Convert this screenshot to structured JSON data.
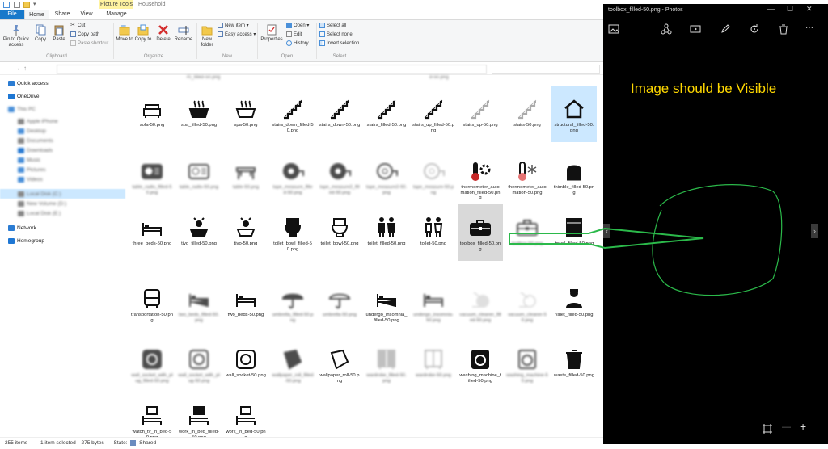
{
  "explorer": {
    "context_tab": "Picture Tools",
    "window_title": "Household",
    "tabs": [
      "File",
      "Home",
      "Share",
      "View",
      "Manage"
    ],
    "ribbon": {
      "pin_label": "Pin to Quick access",
      "copy_label": "Copy",
      "paste_label": "Paste",
      "cut_label": "Cut",
      "copy_path_label": "Copy path",
      "paste_shortcut_label": "Paste shortcut",
      "clipboard_group": "Clipboard",
      "move_to_label": "Move to",
      "copy_to_label": "Copy to",
      "delete_label": "Delete",
      "rename_label": "Rename",
      "organize_group": "Organize",
      "new_folder_label": "New folder",
      "new_item_label": "New item",
      "easy_access_label": "Easy access",
      "new_group": "New",
      "properties_label": "Properties",
      "open_label": "Open",
      "edit_label": "Edit",
      "history_label": "History",
      "open_group": "Open",
      "select_all_label": "Select all",
      "select_none_label": "Select none",
      "invert_selection_label": "Invert selection",
      "select_group": "Select"
    },
    "nav_pane": [
      {
        "label": "Quick access",
        "blur": false,
        "color": "#2b7cd3"
      },
      {
        "label": "OneDrive",
        "blur": false,
        "color": "#1e77d4"
      },
      {
        "label": "This PC",
        "blur": true,
        "color": "#4a90d9"
      },
      {
        "label": "Apple iPhone",
        "blur": true,
        "color": "#888888"
      },
      {
        "label": "Desktop",
        "blur": true,
        "color": "#4a90d9"
      },
      {
        "label": "Documents",
        "blur": true,
        "color": "#888888"
      },
      {
        "label": "Downloads",
        "blur": true,
        "color": "#2b7cd3"
      },
      {
        "label": "Music",
        "blur": true,
        "color": "#4a90d9"
      },
      {
        "label": "Pictures",
        "blur": true,
        "color": "#4a90d9"
      },
      {
        "label": "Videos",
        "blur": true,
        "color": "#4a90d9"
      },
      {
        "label": "Local Disk (C:)",
        "blur": true,
        "color": "#888888"
      },
      {
        "label": "New Volume (D:)",
        "blur": true,
        "color": "#888888"
      },
      {
        "label": "Local Disk (E:)",
        "blur": true,
        "color": "#888888"
      },
      {
        "label": "Network",
        "blur": false,
        "color": "#2b7cd3"
      },
      {
        "label": "Homegroup",
        "blur": false,
        "color": "#1e77d4"
      }
    ],
    "files": [
      {
        "name": "sofa-50.png",
        "icon": "sofa-icon"
      },
      {
        "name": "spa_filled-50.png",
        "icon": "spa-icon"
      },
      {
        "name": "spa-50.png",
        "icon": "spa-icon"
      },
      {
        "name": "stairs_down_filled-50.png",
        "icon": "stairs-icon"
      },
      {
        "name": "stairs_down-50.png",
        "icon": "stairs-icon"
      },
      {
        "name": "stairs_filled-50.png",
        "icon": "stairs-icon"
      },
      {
        "name": "stairs_up_filled-50.png",
        "icon": "stairs-icon"
      },
      {
        "name": "stairs_up-50.png",
        "icon": "stairs-icon"
      },
      {
        "name": "stairs-50.png",
        "icon": "stairs-icon"
      },
      {
        "name": "structural_filled-50.png",
        "icon": "house-icon"
      },
      {
        "name": "table_radio_filled-50.png",
        "icon": "radio-icon"
      },
      {
        "name": "table_radio-50.png",
        "icon": "radio-icon"
      },
      {
        "name": "table-50.png",
        "icon": "table-icon"
      },
      {
        "name": "tape_measure_filled-50.png",
        "icon": "tape-measure-icon"
      },
      {
        "name": "tape_measure2_filled-50.png",
        "icon": "tape-measure-icon"
      },
      {
        "name": "tape_measure2-50.png",
        "icon": "tape-measure-icon"
      },
      {
        "name": "tape_measure-50.png",
        "icon": "tape-measure-icon"
      },
      {
        "name": "thermometer_automation_filled-50.png",
        "icon": "thermometer-gear-icon"
      },
      {
        "name": "thermometer_automation-50.png",
        "icon": "thermometer-snow-icon"
      },
      {
        "name": "thimble_filled-50.png",
        "icon": "thimble-icon"
      },
      {
        "name": "three_beds-50.png",
        "icon": "bed-icon"
      },
      {
        "name": "tivo_filled-50.png",
        "icon": "tivo-icon"
      },
      {
        "name": "tivo-50.png",
        "icon": "tivo-icon"
      },
      {
        "name": "toilet_bowl_filled-50.png",
        "icon": "toilet-icon"
      },
      {
        "name": "toilet_bowl-50.png",
        "icon": "toilet-icon"
      },
      {
        "name": "toilet_filled-50.png",
        "icon": "restroom-icon"
      },
      {
        "name": "toilet-50.png",
        "icon": "restroom-icon"
      },
      {
        "name": "toolbox_filled-50.png",
        "icon": "toolbox-icon"
      },
      {
        "name": "toolbox-50.png",
        "icon": "toolbox-icon"
      },
      {
        "name": "towel_filled-50.png",
        "icon": "towel-icon"
      },
      {
        "name": "transportation-50.png",
        "icon": "bus-icon"
      },
      {
        "name": "two_beds_filled-50.png",
        "icon": "bed-icon"
      },
      {
        "name": "two_beds-50.png",
        "icon": "bed-icon"
      },
      {
        "name": "umbrella_filled-50.png",
        "icon": "umbrella-icon"
      },
      {
        "name": "umbrella-50.png",
        "icon": "umbrella-icon"
      },
      {
        "name": "undergo_insomnia_filled-50.png",
        "icon": "bed-icon"
      },
      {
        "name": "undergo_insomnia-50.png",
        "icon": "bed-icon"
      },
      {
        "name": "vacuum_cleaner_filled-50.png",
        "icon": "vacuum-icon"
      },
      {
        "name": "vacuum_cleaner-50.png",
        "icon": "vacuum-icon"
      },
      {
        "name": "valet_filled-50.png",
        "icon": "valet-icon"
      },
      {
        "name": "wall_socket_with_plug_filled-50.png",
        "icon": "socket-icon"
      },
      {
        "name": "wall_socket_with_plug-50.png",
        "icon": "socket-icon"
      },
      {
        "name": "wall_socket-50.png",
        "icon": "socket-icon"
      },
      {
        "name": "wallpaper_roll_filled-50.png",
        "icon": "wallpaper-icon"
      },
      {
        "name": "wallpaper_roll-50.png",
        "icon": "wallpaper-icon"
      },
      {
        "name": "wardrobe_filled-50.png",
        "icon": "wardrobe-icon"
      },
      {
        "name": "wardrobe-50.png",
        "icon": "wardrobe-icon"
      },
      {
        "name": "washing_machine_filled-50.png",
        "icon": "washing-machine-icon"
      },
      {
        "name": "washing_machine-50.png",
        "icon": "washing-machine-icon"
      },
      {
        "name": "waste_filled-50.png",
        "icon": "trash-icon"
      },
      {
        "name": "watch_tv_in_bed-50.png",
        "icon": "bed-tv-icon"
      },
      {
        "name": "work_in_bed_filled-50.png",
        "icon": "bed-tv-icon"
      },
      {
        "name": "work_in_bed-50.png",
        "icon": "bed-tv-icon"
      }
    ],
    "status": {
      "items": "255 items",
      "selected": "1 item selected",
      "size": "275 bytes",
      "state_label": "State:",
      "state_value": "Shared"
    }
  },
  "photos": {
    "title": "toolbox_filled-50.png - Photos",
    "annotation": "Image should be Visible",
    "annotation_color": "#ffd800",
    "annotation_stroke_color": "#2bb94a"
  }
}
